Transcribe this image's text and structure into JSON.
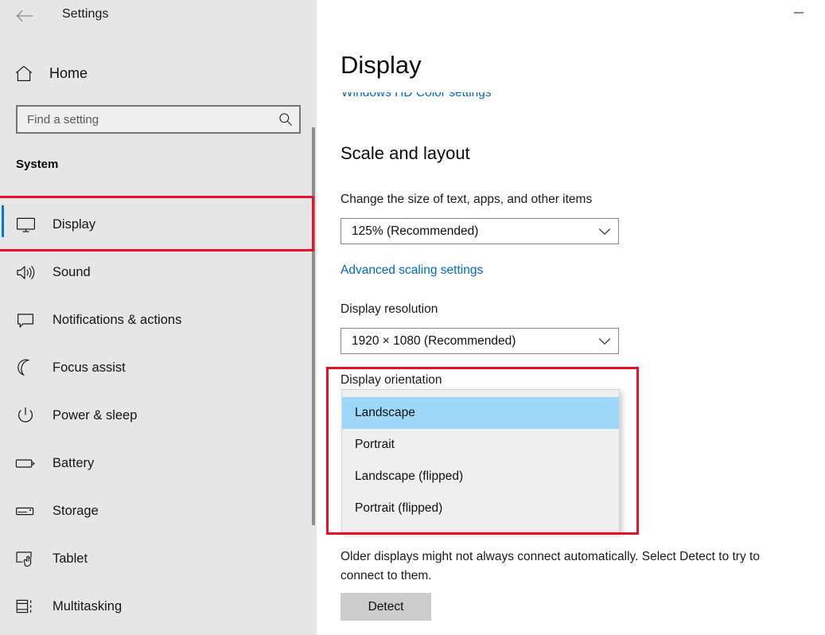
{
  "window": {
    "app_title": "Settings",
    "back_icon": "back-arrow-icon",
    "minimize_label": "Minimize"
  },
  "sidebar": {
    "home_label": "Home",
    "home_icon": "home-icon",
    "search": {
      "placeholder": "Find a setting",
      "value": "",
      "icon": "search-icon"
    },
    "section_title": "System",
    "items": [
      {
        "label": "Display",
        "icon": "monitor-icon",
        "selected": true
      },
      {
        "label": "Sound",
        "icon": "speaker-icon",
        "selected": false
      },
      {
        "label": "Notifications & actions",
        "icon": "notification-icon",
        "selected": false
      },
      {
        "label": "Focus assist",
        "icon": "moon-icon",
        "selected": false
      },
      {
        "label": "Power & sleep",
        "icon": "power-icon",
        "selected": false
      },
      {
        "label": "Battery",
        "icon": "battery-icon",
        "selected": false
      },
      {
        "label": "Storage",
        "icon": "storage-icon",
        "selected": false
      },
      {
        "label": "Tablet",
        "icon": "tablet-icon",
        "selected": false
      },
      {
        "label": "Multitasking",
        "icon": "multitasking-icon",
        "selected": false
      }
    ]
  },
  "main": {
    "page_title": "Display",
    "clipped_link": "Windows HD Color settings",
    "scale_section_title": "Scale and layout",
    "scale_label": "Change the size of text, apps, and other items",
    "scale_value": "125% (Recommended)",
    "advanced_scaling_link": "Advanced scaling settings",
    "resolution_label": "Display resolution",
    "resolution_value": "1920 × 1080 (Recommended)",
    "orientation_label": "Display orientation",
    "orientation_options": [
      "Landscape",
      "Portrait",
      "Landscape (flipped)",
      "Portrait (flipped)"
    ],
    "orientation_selected": "Landscape",
    "detect_note": "Older displays might not always connect automatically. Select Detect to try to connect to them.",
    "detect_button": "Detect"
  },
  "colors": {
    "accent": "#0078d7",
    "link": "#0069c0",
    "sidebar_bg": "#e6e6e6",
    "highlight": "#9ed7f7",
    "annotation": "#e8112d"
  }
}
